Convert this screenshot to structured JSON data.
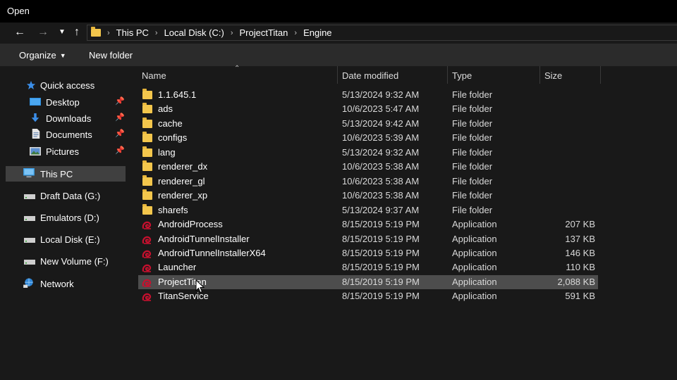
{
  "window": {
    "title": "Open"
  },
  "address": {
    "crumbs": [
      "This PC",
      "Local Disk (C:)",
      "ProjectTitan",
      "Engine"
    ]
  },
  "toolbar": {
    "organize_label": "Organize",
    "new_folder_label": "New folder"
  },
  "nav": {
    "quick_access": "Quick access",
    "pinned": [
      {
        "label": "Desktop",
        "icon": "desktop-icon"
      },
      {
        "label": "Downloads",
        "icon": "download-icon"
      },
      {
        "label": "Documents",
        "icon": "document-icon"
      },
      {
        "label": "Pictures",
        "icon": "pictures-icon"
      }
    ],
    "this_pc": "This PC",
    "drives": [
      "Draft Data (G:)",
      "Emulators (D:)",
      "Local Disk (E:)",
      "New Volume (F:)"
    ],
    "network": "Network"
  },
  "columns": {
    "name": "Name",
    "date": "Date modified",
    "type": "Type",
    "size": "Size"
  },
  "files": [
    {
      "name": "1.1.645.1",
      "date": "5/13/2024 9:32 AM",
      "type": "File folder",
      "size": "",
      "kind": "folder"
    },
    {
      "name": "ads",
      "date": "10/6/2023 5:47 AM",
      "type": "File folder",
      "size": "",
      "kind": "folder"
    },
    {
      "name": "cache",
      "date": "5/13/2024 9:42 AM",
      "type": "File folder",
      "size": "",
      "kind": "folder"
    },
    {
      "name": "configs",
      "date": "10/6/2023 5:39 AM",
      "type": "File folder",
      "size": "",
      "kind": "folder"
    },
    {
      "name": "lang",
      "date": "5/13/2024 9:32 AM",
      "type": "File folder",
      "size": "",
      "kind": "folder"
    },
    {
      "name": "renderer_dx",
      "date": "10/6/2023 5:38 AM",
      "type": "File folder",
      "size": "",
      "kind": "folder"
    },
    {
      "name": "renderer_gl",
      "date": "10/6/2023 5:38 AM",
      "type": "File folder",
      "size": "",
      "kind": "folder"
    },
    {
      "name": "renderer_xp",
      "date": "10/6/2023 5:38 AM",
      "type": "File folder",
      "size": "",
      "kind": "folder"
    },
    {
      "name": "sharefs",
      "date": "5/13/2024 9:37 AM",
      "type": "File folder",
      "size": "",
      "kind": "folder"
    },
    {
      "name": "AndroidProcess",
      "date": "8/15/2019 5:19 PM",
      "type": "Application",
      "size": "207 KB",
      "kind": "app"
    },
    {
      "name": "AndroidTunnelInstaller",
      "date": "8/15/2019 5:19 PM",
      "type": "Application",
      "size": "137 KB",
      "kind": "app"
    },
    {
      "name": "AndroidTunnelInstallerX64",
      "date": "8/15/2019 5:19 PM",
      "type": "Application",
      "size": "146 KB",
      "kind": "app"
    },
    {
      "name": "Launcher",
      "date": "8/15/2019 5:19 PM",
      "type": "Application",
      "size": "110 KB",
      "kind": "app"
    },
    {
      "name": "ProjectTitan",
      "date": "8/15/2019 5:19 PM",
      "type": "Application",
      "size": "2,088 KB",
      "kind": "app"
    },
    {
      "name": "TitanService",
      "date": "8/15/2019 5:19 PM",
      "type": "Application",
      "size": "591 KB",
      "kind": "app"
    }
  ],
  "hovered_file": "ProjectTitan",
  "colors": {
    "folder": "#f3c64c",
    "app_icon": "#c8102e",
    "selection": "#4d4d4d",
    "nav_selected": "#404040"
  }
}
